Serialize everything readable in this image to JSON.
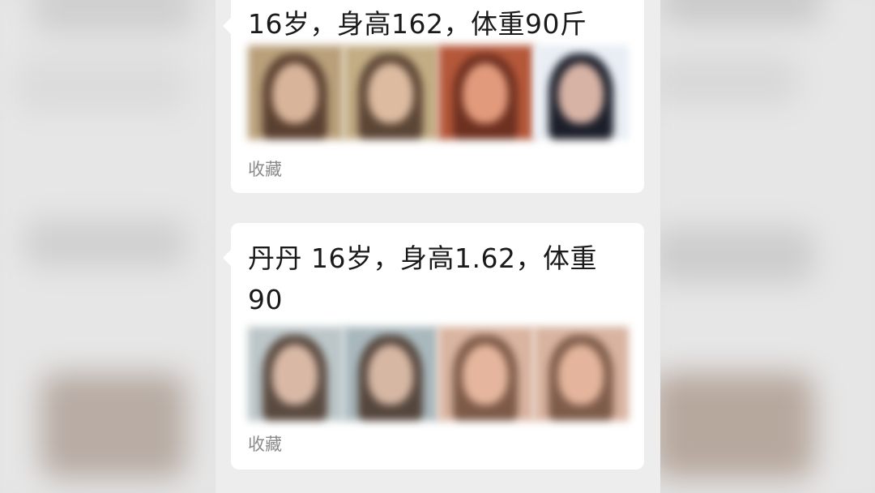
{
  "cards": [
    {
      "title": "16岁，身高162，体重90斤",
      "favorite_label": "收藏",
      "thumbnails": [
        {
          "name": "photo-1",
          "bg": "#b9a07a",
          "hair": "#5a4030",
          "face": "#d8b49a"
        },
        {
          "name": "photo-2",
          "bg": "#c2ad84",
          "hair": "#5b4535",
          "face": "#dcbba0"
        },
        {
          "name": "photo-3",
          "bg": "#b5583a",
          "hair": "#6e3020",
          "face": "#e29a7c"
        },
        {
          "name": "photo-4",
          "bg": "#e8eef4",
          "hair": "#1c1f2a",
          "face": "#d7b3a5"
        }
      ]
    },
    {
      "title_line1": "丹丹 16岁，身高1.62，体重",
      "title_line2": "90",
      "favorite_label": "收藏",
      "thumbnails": [
        {
          "name": "photo-1",
          "bg": "#bcc6c8",
          "hair": "#5a4a40",
          "face": "#d9b9a6"
        },
        {
          "name": "photo-2",
          "bg": "#a9b8bd",
          "hair": "#55463d",
          "face": "#d6b7a3"
        },
        {
          "name": "photo-3",
          "bg": "#d9b4a0",
          "hair": "#7d5a48",
          "face": "#e5b69d"
        },
        {
          "name": "photo-4",
          "bg": "#d8b3a0",
          "hair": "#7e5c4a",
          "face": "#e4b59c"
        }
      ]
    }
  ]
}
